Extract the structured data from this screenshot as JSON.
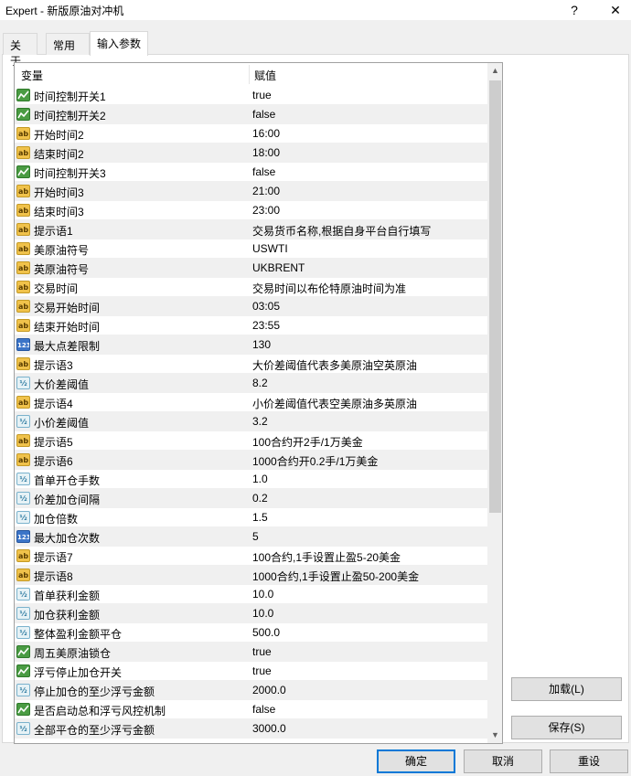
{
  "window": {
    "title": "Expert - 新版原油对冲机",
    "help_glyph": "?",
    "close_glyph": "✕"
  },
  "tabs": [
    {
      "label": "关于"
    },
    {
      "label": "常用"
    },
    {
      "label": "输入参数"
    }
  ],
  "grid": {
    "col_variable": "变量",
    "col_value": "赋值",
    "rows": [
      {
        "type": "bool",
        "name": "时间控制开关1",
        "value": "true"
      },
      {
        "type": "bool",
        "name": "时间控制开关2",
        "value": "false"
      },
      {
        "type": "str",
        "name": "开始时间2",
        "value": "16:00"
      },
      {
        "type": "str",
        "name": "结束时间2",
        "value": "18:00"
      },
      {
        "type": "bool",
        "name": "时间控制开关3",
        "value": "false"
      },
      {
        "type": "str",
        "name": "开始时间3",
        "value": "21:00"
      },
      {
        "type": "str",
        "name": "结束时间3",
        "value": "23:00"
      },
      {
        "type": "str",
        "name": "提示语1",
        "value": "交易货币名称,根据自身平台自行填写"
      },
      {
        "type": "str",
        "name": "美原油符号",
        "value": "USWTI"
      },
      {
        "type": "str",
        "name": "英原油符号",
        "value": "UKBRENT"
      },
      {
        "type": "str",
        "name": "交易时间",
        "value": "交易时间以布伦特原油时间为准"
      },
      {
        "type": "str",
        "name": "交易开始时间",
        "value": "03:05"
      },
      {
        "type": "str",
        "name": "结束开始时间",
        "value": "23:55"
      },
      {
        "type": "int",
        "name": "最大点差限制",
        "value": "130"
      },
      {
        "type": "str",
        "name": "提示语3",
        "value": "大价差阈值代表多美原油空英原油"
      },
      {
        "type": "dbl",
        "name": "大价差阈值",
        "value": "8.2"
      },
      {
        "type": "str",
        "name": "提示语4",
        "value": "小价差阈值代表空美原油多英原油"
      },
      {
        "type": "dbl",
        "name": "小价差阈值",
        "value": "3.2"
      },
      {
        "type": "str",
        "name": "提示语5",
        "value": "100合约开2手/1万美金"
      },
      {
        "type": "str",
        "name": "提示语6",
        "value": "1000合约开0.2手/1万美金"
      },
      {
        "type": "dbl",
        "name": "首单开仓手数",
        "value": "1.0"
      },
      {
        "type": "dbl",
        "name": "价差加仓间隔",
        "value": "0.2"
      },
      {
        "type": "dbl",
        "name": "加仓倍数",
        "value": "1.5"
      },
      {
        "type": "int",
        "name": "最大加仓次数",
        "value": "5"
      },
      {
        "type": "str",
        "name": "提示语7",
        "value": "100合约,1手设置止盈5-20美金"
      },
      {
        "type": "str",
        "name": "提示语8",
        "value": "1000合约,1手设置止盈50-200美金"
      },
      {
        "type": "dbl",
        "name": "首单获利金额",
        "value": "10.0"
      },
      {
        "type": "dbl",
        "name": "加仓获利金额",
        "value": "10.0"
      },
      {
        "type": "dbl",
        "name": "整体盈利金额平仓",
        "value": "500.0"
      },
      {
        "type": "bool",
        "name": "周五美原油锁仓",
        "value": "true"
      },
      {
        "type": "bool",
        "name": "浮亏停止加仓开关",
        "value": "true"
      },
      {
        "type": "dbl",
        "name": "停止加仓的至少浮亏金额",
        "value": "2000.0"
      },
      {
        "type": "bool",
        "name": "是否启动总和浮亏风控机制",
        "value": "false"
      },
      {
        "type": "dbl",
        "name": "全部平仓的至少浮亏金额",
        "value": "3000.0"
      }
    ],
    "icon_text": {
      "str": "ab",
      "int": "123",
      "dbl": "½"
    }
  },
  "buttons": {
    "load": "加载(L)",
    "save": "保存(S)",
    "ok": "确定",
    "cancel": "取消",
    "reset": "重设"
  }
}
